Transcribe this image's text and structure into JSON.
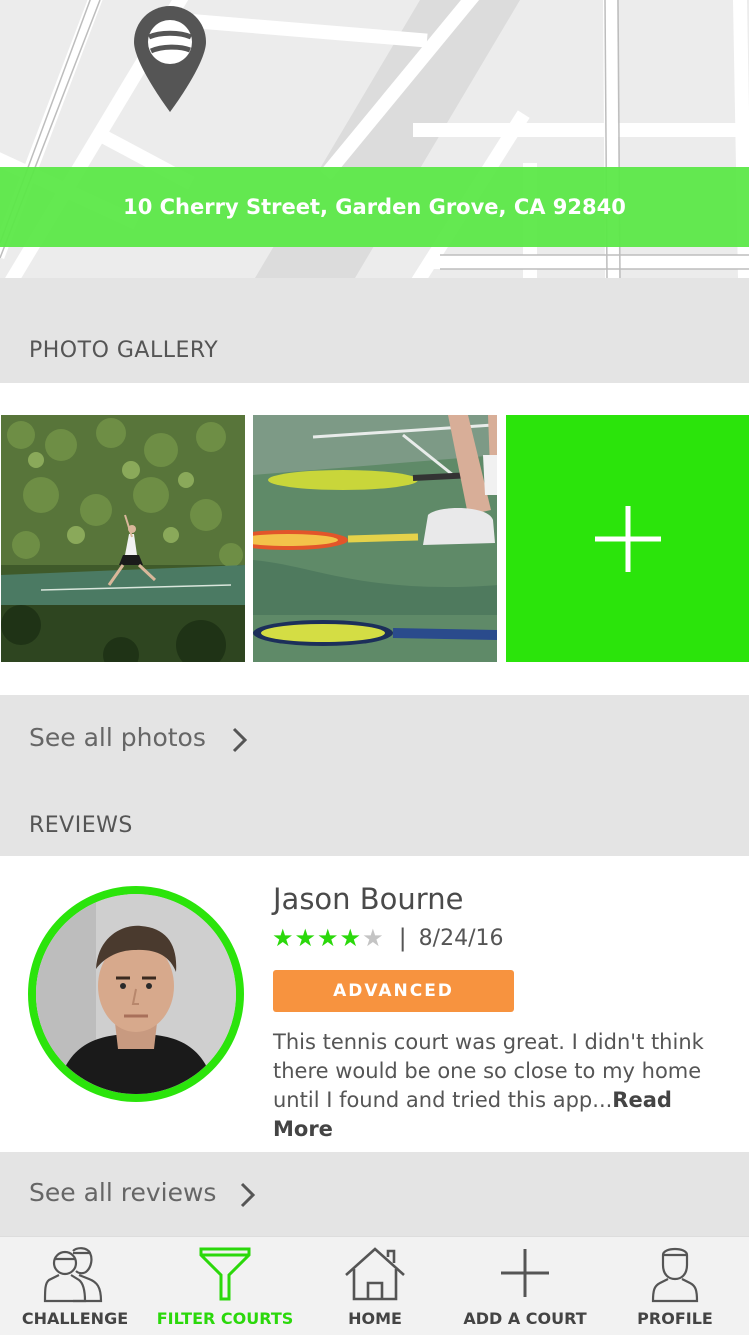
{
  "map": {
    "address": "10 Cherry Street, Garden Grove, CA 92840",
    "pin_icon": "map-pin-tennis-ball-icon"
  },
  "gallery": {
    "title": "PHOTO GALLERY",
    "add_icon": "plus-icon",
    "see_all_label": "See all photos"
  },
  "reviews": {
    "title": "REVIEWS",
    "items": [
      {
        "name": "Jason Bourne",
        "rating": 4,
        "rating_max": 5,
        "date": "8/24/16",
        "level": "ADVANCED",
        "text": "This tennis court was great. I didn't think there would be one so close to my home until I found and tried this app...",
        "read_more": "Read More"
      }
    ],
    "see_all_label": "See all reviews"
  },
  "tabbar": {
    "active": "filter-courts",
    "tabs": [
      {
        "label": "CHALLENGE",
        "icon": "two-players-icon"
      },
      {
        "label": "FILTER COURTS",
        "icon": "funnel-icon"
      },
      {
        "label": "HOME",
        "icon": "house-icon"
      },
      {
        "label": "ADD A COURT",
        "icon": "plus-icon"
      },
      {
        "label": "PROFILE",
        "icon": "player-icon"
      }
    ]
  },
  "colors": {
    "accent_green": "#2be40b",
    "banner_green": "#5ce848",
    "level_orange": "#f7933f",
    "star_filled": "#2bd80b",
    "star_empty": "#c4c4c4"
  }
}
